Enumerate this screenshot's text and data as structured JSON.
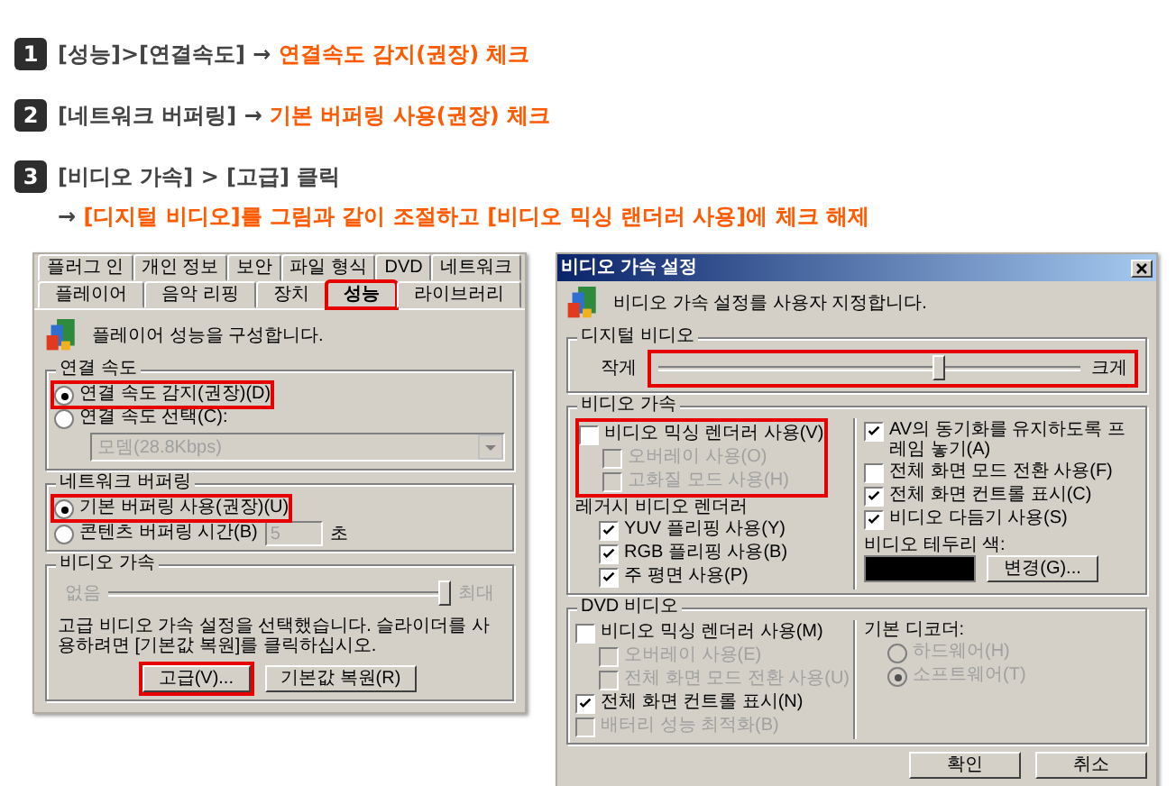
{
  "steps": [
    {
      "number": "1",
      "lines": [
        [
          {
            "text": "[성능]>[연결속도] → ",
            "highlight": false
          },
          {
            "text": "연결속도 감지(권장) 체크",
            "highlight": true
          }
        ]
      ]
    },
    {
      "number": "2",
      "lines": [
        [
          {
            "text": "[네트워크 버퍼링] → ",
            "highlight": false
          },
          {
            "text": "기본 버퍼링 사용(권장) 체크",
            "highlight": true
          }
        ]
      ]
    },
    {
      "number": "3",
      "lines": [
        [
          {
            "text": "[비디오 가속] > [고급] 클릭",
            "highlight": false
          }
        ],
        [
          {
            "text": "→ ",
            "highlight": false
          },
          {
            "text": "[디지털 비디오]를 그림과 같이 조절하고 [비디오 믹싱 랜더러 사용]에 체크 해제",
            "highlight": true
          }
        ]
      ]
    }
  ],
  "player_options": {
    "tab_rows": [
      [
        {
          "label": "플러그 인",
          "selected": false,
          "highlighted": false
        },
        {
          "label": "개인 정보",
          "selected": false,
          "highlighted": false
        },
        {
          "label": "보안",
          "selected": false,
          "highlighted": false
        },
        {
          "label": "파일 형식",
          "selected": false,
          "highlighted": false
        },
        {
          "label": "DVD",
          "selected": false,
          "highlighted": false
        },
        {
          "label": "네트워크",
          "selected": false,
          "highlighted": false
        }
      ],
      [
        {
          "label": "플레이어",
          "selected": false,
          "highlighted": false
        },
        {
          "label": "음악 리핑",
          "selected": false,
          "highlighted": false
        },
        {
          "label": "장치",
          "selected": false,
          "highlighted": false
        },
        {
          "label": "성능",
          "selected": true,
          "highlighted": true
        },
        {
          "label": "라이브러리",
          "selected": false,
          "highlighted": false
        }
      ]
    ],
    "header": "플레이어 성능을 구성합니다.",
    "connection": {
      "title": "연결 속도",
      "options": [
        {
          "label": "연결 속도 감지(권장)(D)",
          "selected": true,
          "highlighted": true
        },
        {
          "label": "연결 속도 선택(C):",
          "selected": false,
          "highlighted": false
        }
      ],
      "dropdown": {
        "value": "모뎀(28.8Kbps)",
        "disabled": true
      }
    },
    "buffering": {
      "title": "네트워크 버퍼링",
      "options": [
        {
          "label": "기본 버퍼링 사용(권장)(U)",
          "selected": true,
          "highlighted": true
        },
        {
          "label": "콘텐츠 버퍼링 시간(B)",
          "selected": false,
          "highlighted": false
        }
      ],
      "seconds": {
        "value": "5",
        "disabled": true
      },
      "unit": "초"
    },
    "acceleration": {
      "title": "비디오 가속",
      "min_label": "없음",
      "max_label": "최대",
      "level": 1,
      "disabled": true,
      "note": "고급 비디오 가속 설정을 선택했습니다. 슬라이더를 사용하려면 [기본값 복원]를 클릭하십시오."
    },
    "buttons": [
      {
        "label": "고급(V)...",
        "highlighted": true
      },
      {
        "label": "기본값 복원(R)",
        "highlighted": false
      }
    ]
  },
  "accel_dialog": {
    "title": "비디오 가속 설정",
    "header": "비디오 가속 설정를 사용자 지정합니다.",
    "digital_video": {
      "title": "디지털 비디오",
      "min_label": "작게",
      "max_label": "크게",
      "level": 0.67,
      "highlighted": true
    },
    "video_accel": {
      "title": "비디오 가속",
      "left": [
        {
          "kind": "checkbox",
          "label": "비디오 믹싱 렌더러 사용(V)",
          "checked": false,
          "disabled": false,
          "highlighted": true,
          "children": [
            {
              "kind": "checkbox",
              "label": "오버레이 사용(O)",
              "checked": false,
              "disabled": true
            },
            {
              "kind": "checkbox",
              "label": "고화질 모드 사용(H)",
              "checked": false,
              "disabled": true
            }
          ]
        },
        {
          "kind": "heading",
          "label": "레거시 비디오 렌더러",
          "children": [
            {
              "kind": "checkbox",
              "label": "YUV 플리핑 사용(Y)",
              "checked": true,
              "disabled": false
            },
            {
              "kind": "checkbox",
              "label": "RGB 플리핑 사용(B)",
              "checked": true,
              "disabled": false
            },
            {
              "kind": "checkbox",
              "label": "주 평면 사용(P)",
              "checked": true,
              "disabled": false
            }
          ]
        }
      ],
      "right": [
        {
          "kind": "checkbox",
          "label": "AV의 동기화를 유지하도록 프레임 놓기(A)",
          "checked": true,
          "disabled": false
        },
        {
          "kind": "checkbox",
          "label": "전체 화면 모드 전환 사용(F)",
          "checked": false,
          "disabled": false
        },
        {
          "kind": "checkbox",
          "label": "전체 화면 컨트롤 표시(C)",
          "checked": true,
          "disabled": false
        },
        {
          "kind": "checkbox",
          "label": "비디오 다듬기 사용(S)",
          "checked": true,
          "disabled": false
        }
      ],
      "border_color_label": "비디오 테두리 색:",
      "change_button": "변경(G)..."
    },
    "dvd": {
      "title": "DVD 비디오",
      "left": [
        {
          "kind": "checkbox",
          "label": "비디오 믹싱 렌더러 사용(M)",
          "checked": false,
          "disabled": false,
          "children": [
            {
              "kind": "checkbox",
              "label": "오버레이 사용(E)",
              "checked": false,
              "disabled": true
            },
            {
              "kind": "checkbox",
              "label": "전체 화면 모드 전환 사용(U)",
              "checked": false,
              "disabled": true
            }
          ]
        },
        {
          "kind": "checkbox",
          "label": "전체 화면 컨트롤 표시(N)",
          "checked": true,
          "disabled": false
        },
        {
          "kind": "checkbox",
          "label": "배터리 성능 최적화(B)",
          "checked": false,
          "disabled": true
        }
      ],
      "decoder_label": "기본 디코더:",
      "decoders": [
        {
          "kind": "radio",
          "label": "하드웨어(H)",
          "selected": false,
          "disabled": true
        },
        {
          "kind": "radio",
          "label": "소프트웨어(T)",
          "selected": true,
          "disabled": true
        }
      ]
    },
    "buttons": [
      "확인",
      "취소"
    ]
  }
}
